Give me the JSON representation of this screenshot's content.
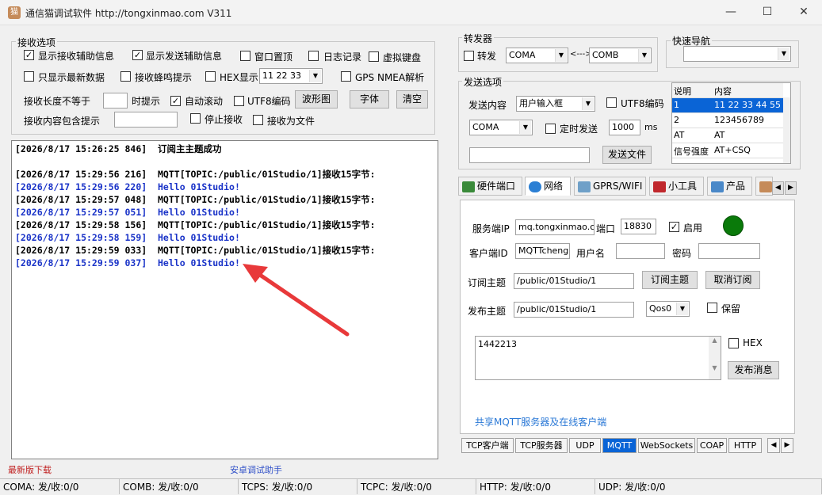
{
  "window": {
    "title": "通信猫调试软件  http://tongxinmao.com  V311",
    "icon": "cat-icon"
  },
  "receive_options": {
    "legend": "接收选项",
    "show_recv_info": "显示接收辅助信息",
    "show_send_info": "显示发送辅助信息",
    "window_top": "窗口置顶",
    "log_record": "日志记录",
    "virtual_keyboard": "虚拟键盘",
    "only_latest": "只显示最新数据",
    "beep": "接收蜂鸣提示",
    "hex_display": "HEX显示",
    "hex_value": "11 22 33",
    "gps": "GPS NMEA解析",
    "recv_len": "接收长度不等于",
    "prompt": "时提示",
    "auto_scroll": "自动滚动",
    "utf8": "UTF8编码",
    "waveform": "波形图",
    "font": "字体",
    "clear": "清空",
    "contains": "接收内容包含提示",
    "stop_recv": "停止接收",
    "recv_to_file": "接收为文件"
  },
  "log": [
    {
      "text": "[2026/8/17 15:26:25 846]  订阅主主题成功",
      "color": "blk"
    },
    {
      "text": "",
      "color": "blk"
    },
    {
      "text": "[2026/8/17 15:29:56 216]  MQTT[TOPIC:/public/01Studio/1]接收15字节:",
      "color": "blk"
    },
    {
      "text": "[2026/8/17 15:29:56 220]  Hello 01Studio!",
      "color": "blu"
    },
    {
      "text": "[2026/8/17 15:29:57 048]  MQTT[TOPIC:/public/01Studio/1]接收15字节:",
      "color": "blk"
    },
    {
      "text": "[2026/8/17 15:29:57 051]  Hello 01Studio!",
      "color": "blu"
    },
    {
      "text": "[2026/8/17 15:29:58 156]  MQTT[TOPIC:/public/01Studio/1]接收15字节:",
      "color": "blk"
    },
    {
      "text": "[2026/8/17 15:29:58 159]  Hello 01Studio!",
      "color": "blu"
    },
    {
      "text": "[2026/8/17 15:29:59 033]  MQTT[TOPIC:/public/01Studio/1]接收15字节:",
      "color": "blk"
    },
    {
      "text": "[2026/8/17 15:29:59 037]  Hello 01Studio!",
      "color": "blu"
    }
  ],
  "forwarder": {
    "legend": "转发器",
    "forward": "转发",
    "port_a": "COMA",
    "arrow": "<--->",
    "port_b": "COMB"
  },
  "quick_nav": {
    "legend": "快速导航",
    "value": ""
  },
  "send_options": {
    "legend": "发送选项",
    "content_label": "发送内容",
    "content_mode": "用户输入框",
    "utf8": "UTF8编码",
    "port": "COMA",
    "timed_send": "定时发送",
    "interval": "1000",
    "unit": "ms",
    "send_file": "发送文件",
    "table_headers": [
      "说明",
      "内容"
    ],
    "table_rows": [
      [
        "1",
        "11 22 33 44 55"
      ],
      [
        "2",
        "123456789"
      ],
      [
        "AT",
        "AT"
      ],
      [
        "信号强度",
        "AT+CSQ"
      ]
    ]
  },
  "tabs": [
    "硬件端口",
    "网络",
    "GPRS/WIFI",
    "小工具",
    "产品"
  ],
  "mqtt": {
    "server_label": "服务端IP",
    "server": "mq.tongxinmao.com",
    "port_label": "端口",
    "port": "18830",
    "enable": "启用",
    "client_label": "客户端ID",
    "client": "MQTTcheng",
    "user_label": "用户名",
    "user": "",
    "pwd_label": "密码",
    "pwd": "",
    "sub_label": "订阅主题",
    "sub_topic": "/public/01Studio/1",
    "subscribe": "订阅主题",
    "unsubscribe": "取消订阅",
    "pub_label": "发布主题",
    "pub_topic": "/public/01Studio/1",
    "qos": "Qos0",
    "retain": "保留",
    "message": "1442213",
    "hex": "HEX",
    "publish": "发布消息",
    "share_link": "共享MQTT服务器及在线客户端"
  },
  "bottom_tabs": [
    "TCP客户端",
    "TCP服务器",
    "UDP",
    "MQTT",
    "WebSockets",
    "COAP",
    "HTTP"
  ],
  "links": {
    "download": "最新版下载",
    "android": "安卓调试助手"
  },
  "status": [
    "COMA: 发/收:0/0",
    "COMB: 发/收:0/0",
    "TCPS: 发/收:0/0",
    "TCPC: 发/收:0/0",
    "HTTP: 发/收:0/0",
    "UDP: 发/收:0/0"
  ]
}
